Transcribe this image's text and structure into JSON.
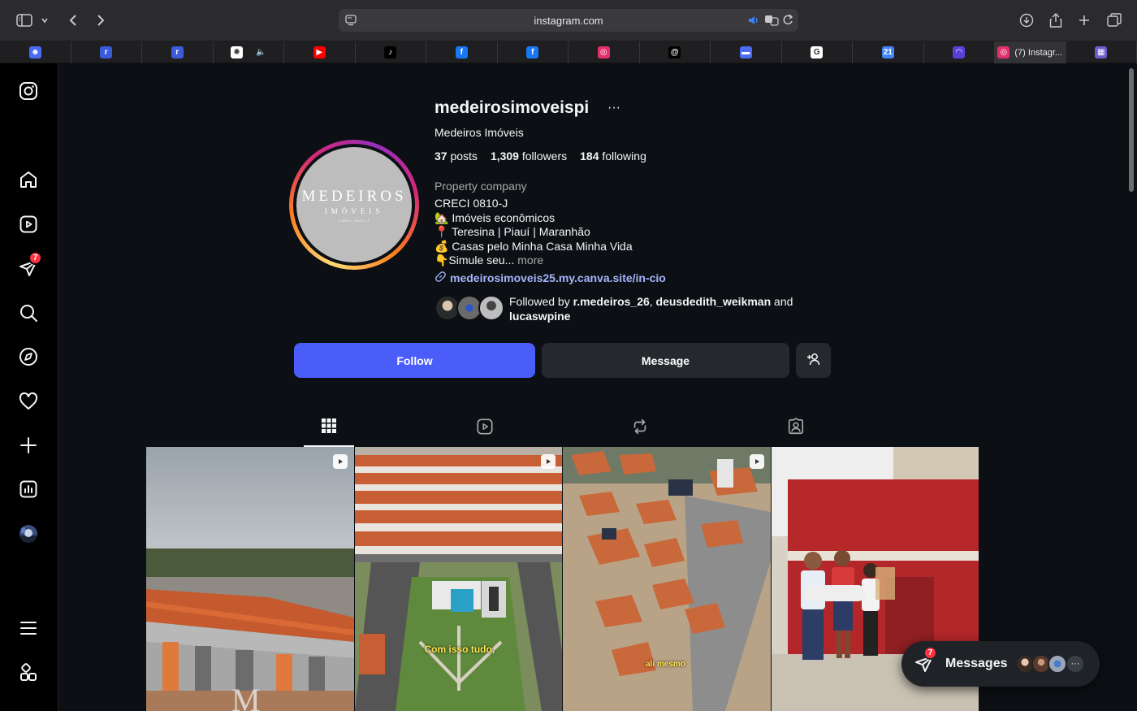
{
  "browser": {
    "url": "instagram.com",
    "active_tab_title": "(7) Instagr..."
  },
  "tabs": [
    {
      "name": "reddit-like-tab",
      "color": "#4b6cf0",
      "glyph": "☻"
    },
    {
      "name": "tab-blue-1",
      "color": "#3b5bdb",
      "glyph": "r"
    },
    {
      "name": "tab-blue-2",
      "color": "#3b5bdb",
      "glyph": "r"
    },
    {
      "name": "tab-chatgpt",
      "color": "#ffffff",
      "glyph": "✺"
    },
    {
      "name": "tab-youtube",
      "color": "#ff0000",
      "glyph": "▶"
    },
    {
      "name": "tab-tiktok",
      "color": "#000000",
      "glyph": "♪"
    },
    {
      "name": "tab-facebook-1",
      "color": "#1877f2",
      "glyph": "f"
    },
    {
      "name": "tab-facebook-2",
      "color": "#1877f2",
      "glyph": "f"
    },
    {
      "name": "tab-instagram",
      "color": "#e1306c",
      "glyph": "◎"
    },
    {
      "name": "tab-threads",
      "color": "#000000",
      "glyph": "@"
    },
    {
      "name": "tab-car",
      "color": "#4b6cf0",
      "glyph": "▬"
    },
    {
      "name": "tab-google",
      "color": "#ffffff",
      "glyph": "G"
    },
    {
      "name": "tab-calendar",
      "color": "#4285f4",
      "glyph": "21"
    },
    {
      "name": "tab-arc",
      "color": "#5b3fd9",
      "glyph": "◠"
    },
    {
      "name": "tab-active-instagram",
      "color": "#e1306c",
      "glyph": "◎"
    },
    {
      "name": "tab-last",
      "color": "#6d5bd0",
      "glyph": "▦"
    }
  ],
  "nav": {
    "notifications_badge": "7"
  },
  "profile": {
    "username": "medeirosimoveispi",
    "full_name": "Medeiros Imóveis",
    "posts_count": "37",
    "posts_label": "posts",
    "followers_count": "1,309",
    "followers_label": "followers",
    "following_count": "184",
    "following_label": "following",
    "category": "Property company",
    "bio_lines": [
      "CRECI 0810-J",
      "🏡 Imóveis econômicos",
      "📍 Teresina | Piauí | Maranhão",
      "💰 Casas pelo Minha Casa Minha Vida",
      "👇Simule seu..."
    ],
    "bio_more": "more",
    "link": "medeirosimoveis25.my.canva.site/in-cio",
    "followed_by_prefix": "Followed by",
    "followed_by_1": "r.medeiros_26",
    "followed_by_sep": ",",
    "followed_by_2": "deusdedith_weikman",
    "followed_by_and": "and",
    "followed_by_3": "lucaswpine",
    "avatar_brand": "MEDEIROS",
    "avatar_brand_sub": "IMÓVEIS",
    "avatar_brand_small": "CRECI 0810-J"
  },
  "actions": {
    "follow": "Follow",
    "message": "Message"
  },
  "posts": [
    {
      "caption": "",
      "reel": true
    },
    {
      "caption": "Com isso tudo,",
      "reel": true
    },
    {
      "caption": "ali mesmo",
      "reel": true
    },
    {
      "caption": "",
      "reel": false
    }
  ],
  "messages": {
    "label": "Messages",
    "badge": "7"
  }
}
